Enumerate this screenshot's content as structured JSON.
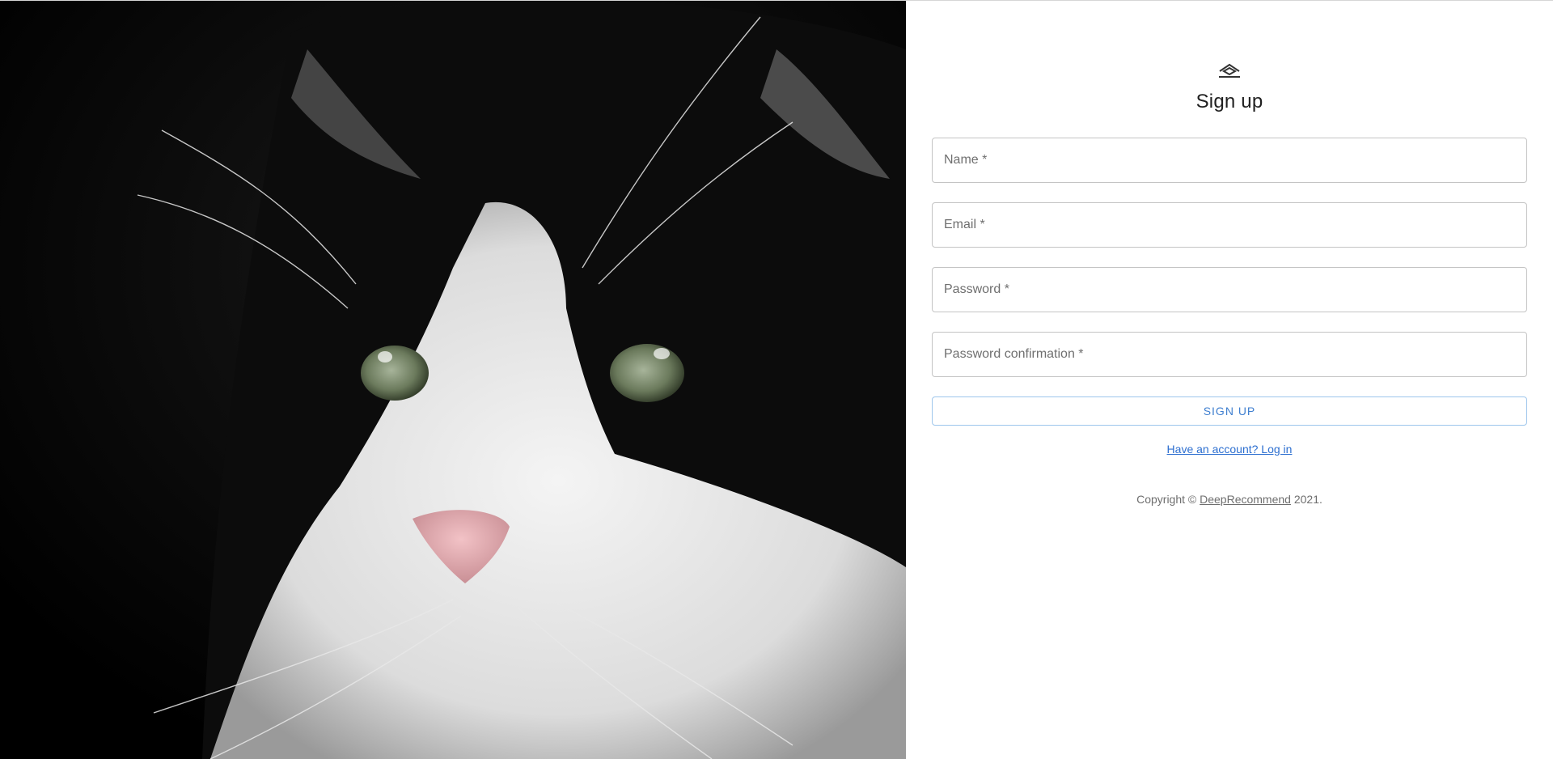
{
  "hero": {
    "image_subject": "black-and-white cat portrait"
  },
  "brand": {
    "icon": "house-logo-icon"
  },
  "page": {
    "title": "Sign up"
  },
  "form": {
    "fields": [
      {
        "name": "name",
        "placeholder": "Name *",
        "value": ""
      },
      {
        "name": "email",
        "placeholder": "Email *",
        "value": ""
      },
      {
        "name": "password",
        "placeholder": "Password *",
        "value": ""
      },
      {
        "name": "password_confirmation",
        "placeholder": "Password confirmation *",
        "value": ""
      }
    ],
    "submit_label": "SIGN UP",
    "login_link": "Have an account? Log in"
  },
  "footer": {
    "prefix": "Copyright ©",
    "brand_link": "DeepRecommend",
    "suffix": "2021."
  },
  "colors": {
    "accent": "#3f7fd0",
    "border": "#c4c4c4",
    "text": "#202020"
  }
}
